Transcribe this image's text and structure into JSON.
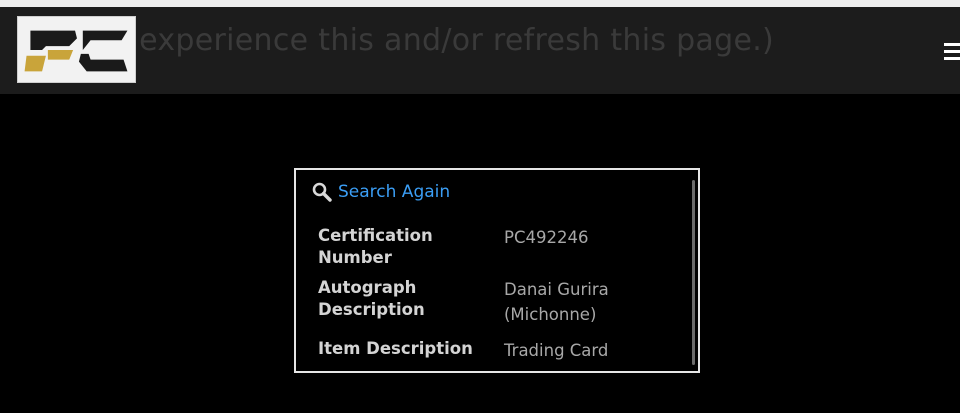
{
  "header": {
    "banner_text": "u experience this and/or refresh this page.)",
    "logo_text": "PC"
  },
  "panel": {
    "search_again_label": "Search Again",
    "rows": [
      {
        "label": "Certification Number",
        "value": "PC492246"
      },
      {
        "label": "Autograph Description",
        "value": "Danai Gurira (Michonne)"
      },
      {
        "label": "Item Description",
        "value": "Trading Card"
      }
    ]
  },
  "colors": {
    "link": "#3b9ef5",
    "logo_gold": "#c9a43a",
    "logo_black": "#1a1a1a"
  },
  "icons": [
    "search-icon",
    "menu-icon"
  ]
}
